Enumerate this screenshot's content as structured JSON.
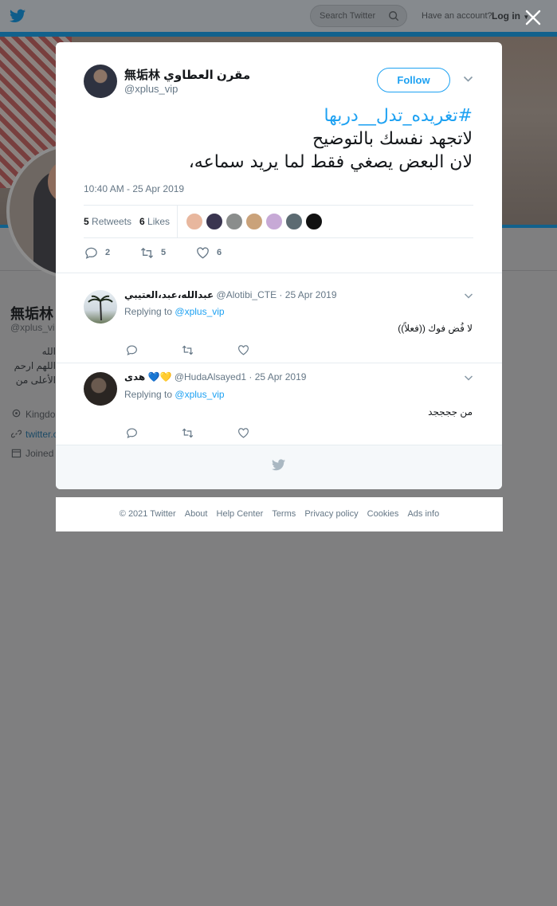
{
  "topbar": {
    "search_placeholder": "Search Twitter",
    "have_account": "Have an account?",
    "login": "Log in"
  },
  "profile_bg": {
    "name": "無垢林",
    "handle": "@xplus_vi",
    "bio_lines": [
      "الله",
      "اللهم ارحم",
      "الأعلى من"
    ],
    "location": "Kingdo",
    "link": "twitter.c",
    "joined": "Joined"
  },
  "tweet": {
    "author_name": "無垢林 مقرن العطاوي",
    "author_handle": "@xplus_vip",
    "follow_label": "Follow",
    "text_line1": "#تغريده_تدل__دربها",
    "text_line2": "لاتجهد نفسك بالتوضيح",
    "text_line3": "لان البعض يصغي فقط لما يريد سماعه،",
    "time": "10:40 AM - 25 Apr 2019",
    "retweets_count": "5",
    "retweets_label": "Retweets",
    "likes_count": "6",
    "likes_label": "Likes",
    "liker_colors": [
      "#e8b79e",
      "#3a3550",
      "#8a8d8c",
      "#caa27a",
      "#c7a9d6",
      "#5c6b72",
      "#111111"
    ],
    "reply_count": "2",
    "retweet_count": "5",
    "like_count": "6"
  },
  "replies": [
    {
      "name": "عبدالله،عبد،العتيبي",
      "handle": "@Alotibi_CTE",
      "date": "25 Apr 2019",
      "replying_label": "Replying to",
      "replying_to": "@xplus_vip",
      "text": "لا فُض فوك ((فعلاً))"
    },
    {
      "name": "هدى",
      "emoji": "💙💛",
      "handle": "@HudaAlsayed1",
      "date": "25 Apr 2019",
      "replying_label": "Replying to",
      "replying_to": "@xplus_vip",
      "text": "من ججججد"
    }
  ],
  "footer": {
    "copyright": "© 2021 Twitter",
    "about": "About",
    "help": "Help Center",
    "terms": "Terms",
    "privacy": "Privacy policy",
    "cookies": "Cookies",
    "ads": "Ads info"
  },
  "colors": {
    "accent": "#1da1f2",
    "overlay_bg": "#7f7f80",
    "banner_strip": "#12618c"
  }
}
